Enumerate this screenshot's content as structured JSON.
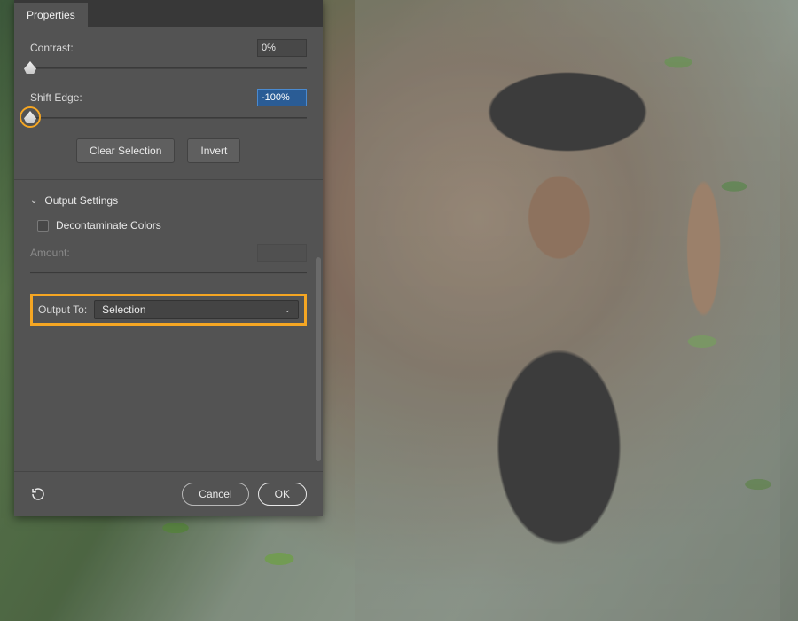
{
  "panel": {
    "tab": "Properties",
    "contrast": {
      "label": "Contrast:",
      "value": "0%",
      "pos": 0
    },
    "shiftEdge": {
      "label": "Shift Edge:",
      "value": "-100%",
      "pos": 0
    },
    "buttons": {
      "clear": "Clear Selection",
      "invert": "Invert"
    },
    "output": {
      "header": "Output Settings",
      "decontam": "Decontaminate Colors",
      "amount": "Amount:",
      "outputTo": "Output To:",
      "selected": "Selection"
    },
    "footer": {
      "cancel": "Cancel",
      "ok": "OK"
    }
  }
}
